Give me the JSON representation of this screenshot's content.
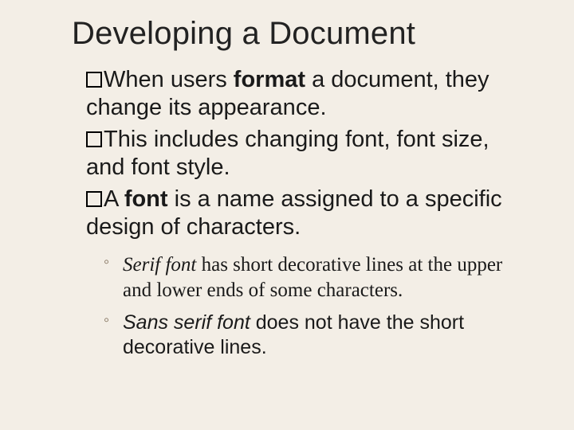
{
  "title": "Developing a Document",
  "paragraphs": {
    "p1": {
      "pre": "When users ",
      "bold": "format",
      "post": " a document, they change its appearance."
    },
    "p2": "This includes changing font, font size, and font style.",
    "p3": {
      "pre": "A ",
      "bold": "font",
      "post": " is a name assigned to a specific design of characters."
    }
  },
  "subitems": {
    "s1": {
      "lead": "Serif font ",
      "rest": "has short decorative lines at the upper and lower ends of some characters."
    },
    "s2": {
      "lead": "Sans serif font ",
      "rest": "does not have the short decorative lines."
    }
  }
}
